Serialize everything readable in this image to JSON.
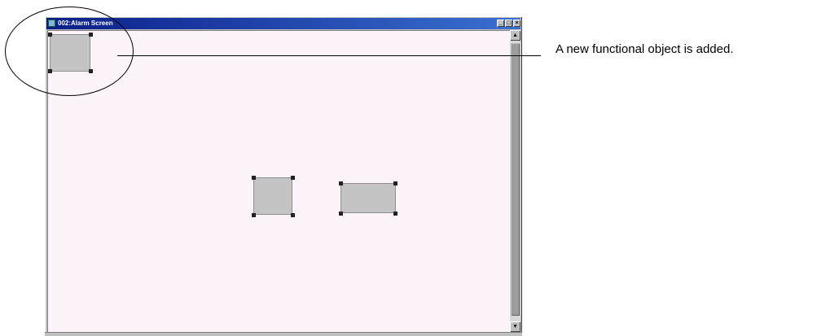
{
  "window": {
    "title": "002:Alarm Screen",
    "controls": {
      "minimize": "_",
      "maximize": "□",
      "close": "×"
    }
  },
  "scrollbar": {
    "up": "▲",
    "down": "▼"
  },
  "callout": {
    "text": "A new functional object is added."
  },
  "objects": [
    {
      "name": "new-functional-object",
      "selected": true
    },
    {
      "name": "functional-object-square",
      "selected": true
    },
    {
      "name": "functional-object-wide",
      "selected": true
    }
  ]
}
